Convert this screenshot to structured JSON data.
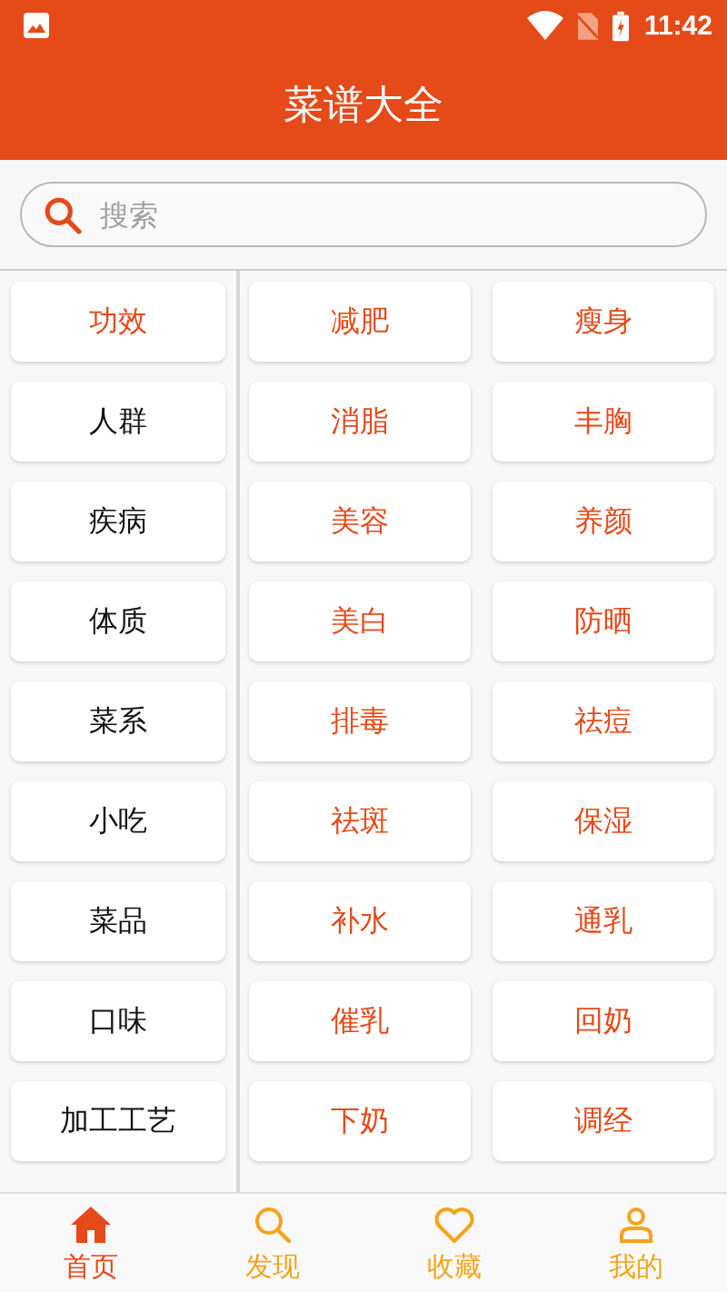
{
  "status_bar": {
    "time": "11:42"
  },
  "title": "菜谱大全",
  "search": {
    "placeholder": "搜索"
  },
  "categories": [
    {
      "label": "功效",
      "selected": true
    },
    {
      "label": "人群",
      "selected": false
    },
    {
      "label": "疾病",
      "selected": false
    },
    {
      "label": "体质",
      "selected": false
    },
    {
      "label": "菜系",
      "selected": false
    },
    {
      "label": "小吃",
      "selected": false
    },
    {
      "label": "菜品",
      "selected": false
    },
    {
      "label": "口味",
      "selected": false
    },
    {
      "label": "加工工艺",
      "selected": false
    }
  ],
  "subcategories": [
    "减肥",
    "瘦身",
    "消脂",
    "丰胸",
    "美容",
    "养颜",
    "美白",
    "防晒",
    "排毒",
    "祛痘",
    "祛斑",
    "保湿",
    "补水",
    "通乳",
    "催乳",
    "回奶",
    "下奶",
    "调经"
  ],
  "nav": [
    {
      "label": "首页",
      "kind": "home",
      "selected": true
    },
    {
      "label": "发现",
      "kind": "discover",
      "selected": false
    },
    {
      "label": "收藏",
      "kind": "favorite",
      "selected": false
    },
    {
      "label": "我的",
      "kind": "profile",
      "selected": false
    }
  ]
}
